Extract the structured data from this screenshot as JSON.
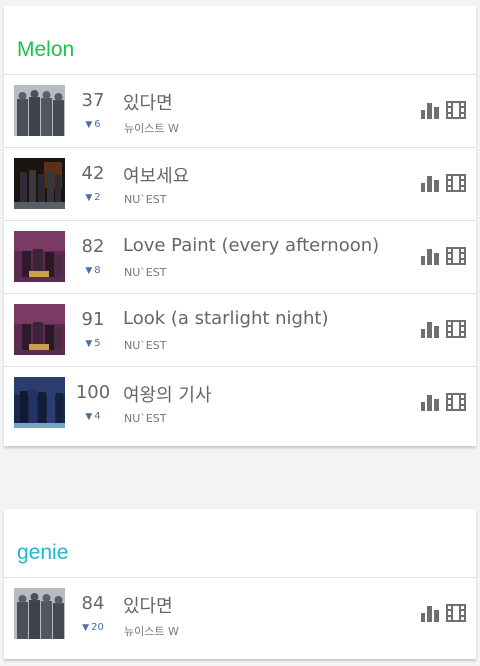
{
  "colors": {
    "melon": "#1ec24a",
    "genie": "#22b5cf",
    "change": "#4a6fa5",
    "icon": "#6f6f6f"
  },
  "melon": {
    "title": "Melon",
    "rows": [
      {
        "rank": "37",
        "change": "6",
        "song": "있다면",
        "artist": "뉴이스트 W",
        "cover": "cover-w-here"
      },
      {
        "rank": "42",
        "change": "2",
        "song": "여보세요",
        "artist": "NU`EST",
        "cover": "cover-hello"
      },
      {
        "rank": "82",
        "change": "8",
        "song": "Love Paint (every afternoon)",
        "artist": "NU`EST",
        "cover": "cover-nuest-lovepaint"
      },
      {
        "rank": "91",
        "change": "5",
        "song": "Look (a starlight night)",
        "artist": "NU`EST",
        "cover": "cover-nuest-look"
      },
      {
        "rank": "100",
        "change": "4",
        "song": "여왕의 기사",
        "artist": "NU`EST",
        "cover": "cover-queens-knight"
      }
    ]
  },
  "genie": {
    "title": "genie",
    "rows": [
      {
        "rank": "84",
        "change": "20",
        "song": "있다면",
        "artist": "뉴이스트 W",
        "cover": "cover-w-here"
      }
    ]
  },
  "icons": {
    "chart": "bar-chart-icon",
    "video": "film-icon"
  }
}
